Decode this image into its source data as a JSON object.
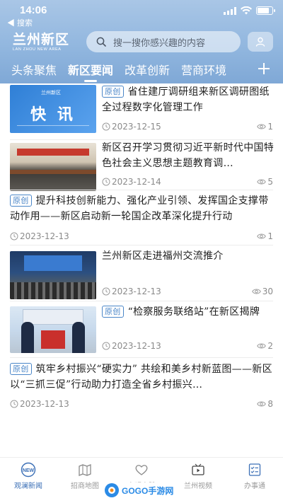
{
  "status_bar": {
    "time": "14:06",
    "back_label": "◀ 搜索"
  },
  "header": {
    "logo_cn": "兰州新区",
    "logo_en": "LAN ZHOU NEW AREA",
    "search_placeholder": "搜一搜你感兴趣的内容",
    "tabs": [
      {
        "label": "头条聚焦",
        "active": false
      },
      {
        "label": "新区要闻",
        "active": true
      },
      {
        "label": "改革创新",
        "active": false
      },
      {
        "label": "营商环境",
        "active": false
      }
    ]
  },
  "feed": [
    {
      "tag": "原创",
      "title": "省住建厅调研组来新区调研图纸全过程数字化管理工作",
      "date": "2023-12-15",
      "views": "1",
      "thumb": "kuaixun",
      "thumb_badge": "兰州新区",
      "thumb_text": "快 讯"
    },
    {
      "tag": "",
      "title": "新区召开学习贯彻习近平新时代中国特色社会主义思想主题教育调…",
      "date": "2023-12-14",
      "views": "5",
      "thumb": "meeting"
    },
    {
      "tag": "原创",
      "title": "提升科技创新能力、强化产业引领、发挥国企支撑带动作用——新区启动新一轮国企改革深化提升行动",
      "date": "2023-12-13",
      "views": "1",
      "thumb": ""
    },
    {
      "tag": "",
      "title": "兰州新区走进福州交流推介",
      "date": "2023-12-13",
      "views": "30",
      "thumb": "conference"
    },
    {
      "tag": "原创",
      "title": "“检察服务联络站”在新区揭牌",
      "date": "2023-12-13",
      "views": "2",
      "thumb": "ceremony"
    },
    {
      "tag": "原创",
      "title": "筑牢乡村振兴“硬实力” 共绘和美乡村新蓝图——新区以“三抓三促”行动助力打造全省乡村振兴…",
      "date": "2023-12-13",
      "views": "8",
      "thumb": ""
    }
  ],
  "bottom_nav": [
    {
      "label": "观澜新闻",
      "icon": "new-badge-icon",
      "active": true
    },
    {
      "label": "招商地图",
      "icon": "map-icon",
      "active": false
    },
    {
      "label": "文明实践",
      "icon": "heart-icon",
      "active": false
    },
    {
      "label": "兰州视频",
      "icon": "video-icon",
      "active": false
    },
    {
      "label": "办事通",
      "icon": "checklist-icon",
      "active": false
    }
  ],
  "watermark": "GOGO手游网",
  "colors": {
    "header_gradient_top": "#a9c6e6",
    "header_gradient_bottom": "#7fa8d6",
    "accent": "#3b6fb6",
    "tag_blue": "#4a86c8"
  }
}
